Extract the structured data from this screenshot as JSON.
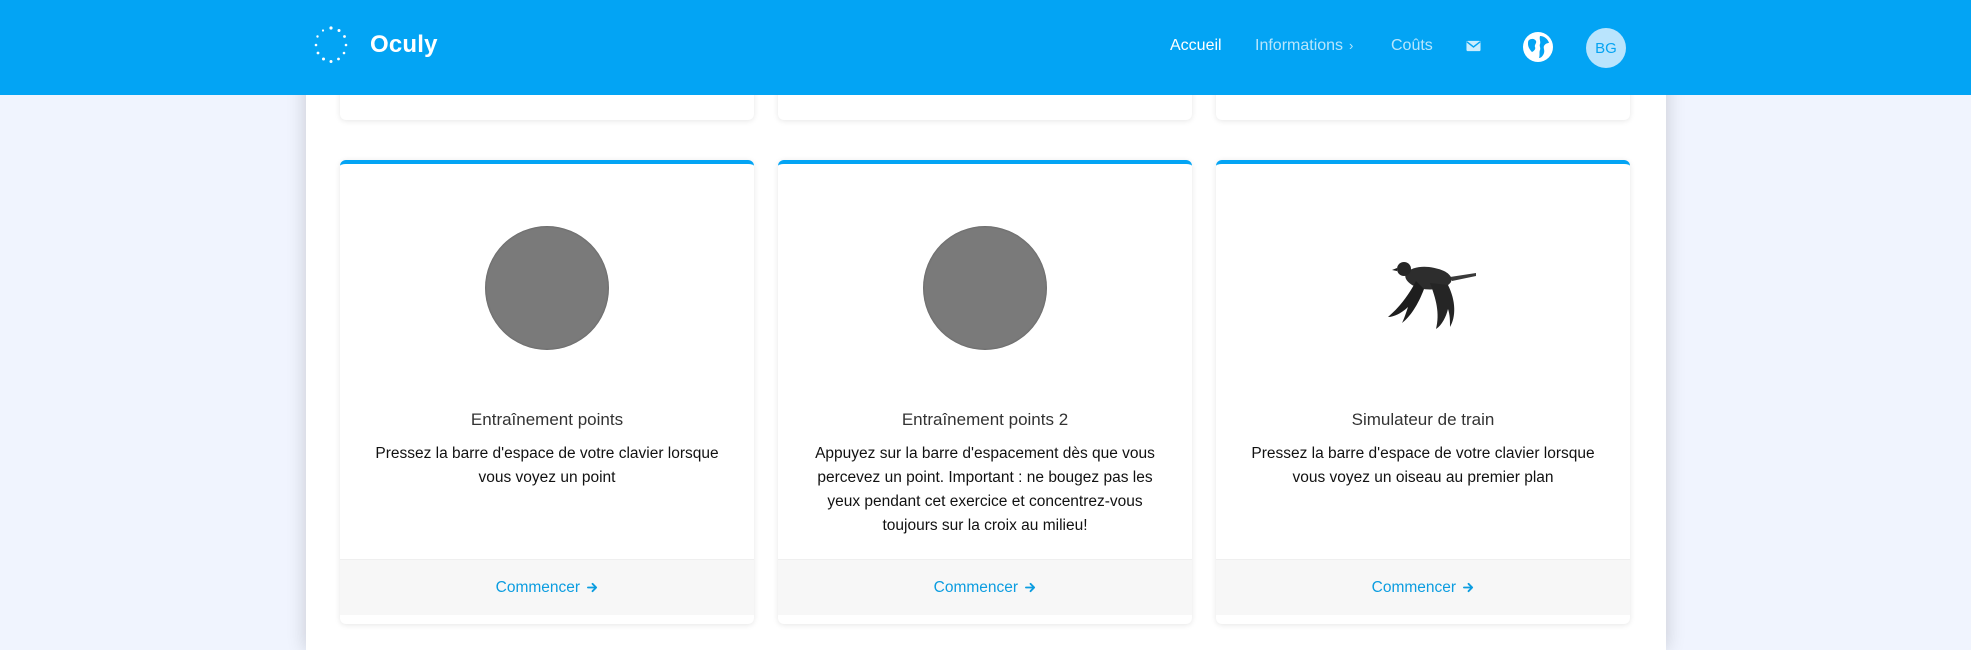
{
  "app": {
    "name": "Oculy"
  },
  "nav": {
    "home_label": "Accueil",
    "info_label": "Informations",
    "costs_label": "Coûts",
    "mail_icon": "envelope-icon",
    "language_icon": "globe-icon",
    "avatar_initials": "BG"
  },
  "colors": {
    "brand": "#03a4f4",
    "background": "#f0f4fe",
    "link": "#0c9de0",
    "stimulus_gray": "#7a7a7a"
  },
  "cards": [
    {
      "title": "Entraînement points",
      "description": "Pressez la barre d'espace de votre clavier lorsque vous voyez un point",
      "figure": "gray-circle",
      "action_label": "Commencer"
    },
    {
      "title": "Entraînement points 2",
      "description": "Appuyez sur la barre d'espacement dès que vous percevez un point. Important : ne bougez pas les yeux pendant cet exercice et concentrez-vous toujours sur la croix au milieu!",
      "figure": "gray-circle",
      "action_label": "Commencer"
    },
    {
      "title": "Simulateur de train",
      "description": "Pressez la barre d'espace de votre clavier lorsque vous voyez un oiseau au premier plan",
      "figure": "bird-image",
      "action_label": "Commencer"
    }
  ]
}
